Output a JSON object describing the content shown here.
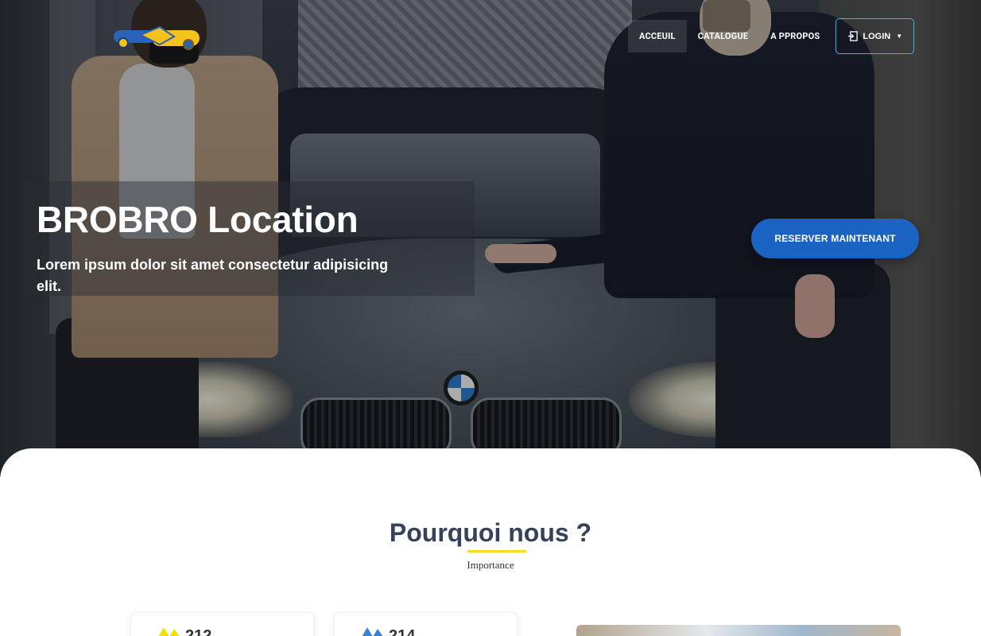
{
  "nav": {
    "links": [
      "ACCEUIL",
      "CATALOGUE",
      "A PPROPOS"
    ],
    "active_index": 0,
    "login_label": "LOGIN"
  },
  "hero": {
    "title": "BROBRO Location",
    "subtitle": "Lorem ipsum dolor sit amet consectetur adipisicing elit.",
    "cta_label": "RESERVER MAINTENANT"
  },
  "section": {
    "title": "Pourquoi nous ?",
    "subtitle": "Importance"
  },
  "stats": [
    {
      "value": "212",
      "icon": "yellow-peaks-icon"
    },
    {
      "value": "214",
      "icon": "blue-peaks-icon"
    }
  ],
  "colors": {
    "accent_blue": "#1b63c2",
    "login_border": "#35b8e6",
    "underline_yellow": "#f4e01f",
    "title_text": "#36415a"
  }
}
